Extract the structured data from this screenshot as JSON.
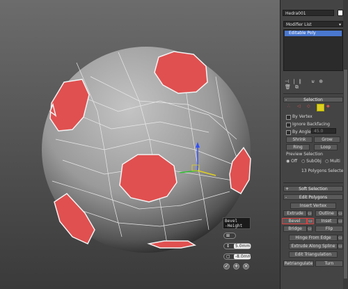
{
  "object_name": "Hedra001",
  "modifier_list": "Modifier List",
  "modifier_stack": [
    "Editable Poly"
  ],
  "selection": {
    "title": "Selection",
    "by_vertex": "By Vertex",
    "ignore_backfacing": "Ignore Backfacing",
    "by_angle": "By Angle:",
    "by_angle_value": "45.0",
    "shrink": "Shrink",
    "grow": "Grow",
    "ring": "Ring",
    "loop": "Loop",
    "preview_selection": "Preview Selection",
    "preview_off": "Off",
    "preview_subobj": "SubObj",
    "preview_multi": "Multi",
    "status": "13 Polygons Selected"
  },
  "soft_selection": "Soft Selection",
  "edit_polygons": {
    "title": "Edit Polygons",
    "insert_vertex": "Insert Vertex",
    "extrude": "Extrude",
    "outline": "Outline",
    "bevel": "Bevel",
    "inset": "Inset",
    "bridge": "Bridge",
    "flip": "Flip",
    "hinge": "Hinge From Edge",
    "extrude_spline": "Extrude Along Spline",
    "edit_triangulation": "Edit Triangulation",
    "retriangulate": "Retriangulate",
    "turn": "Turn"
  },
  "caddy": {
    "label_line1": "Bevel",
    "label_line2": "-Height",
    "height_value": "5.0mm",
    "outline_value": "-8.0mm"
  },
  "colors": {
    "selected_face": "#e05050",
    "panel_bg": "#444444",
    "highlight": "#e04040"
  }
}
